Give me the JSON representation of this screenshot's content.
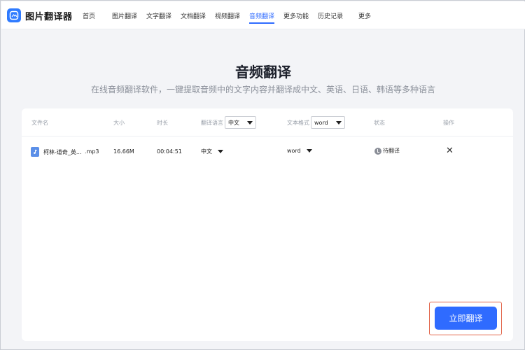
{
  "app": {
    "name": "图片翻译器",
    "accent_color": "#2f6bff"
  },
  "nav": {
    "items": [
      {
        "label": "首页"
      },
      {
        "label": "图片翻译"
      },
      {
        "label": "文字翻译"
      },
      {
        "label": "文档翻译"
      },
      {
        "label": "视频翻译"
      },
      {
        "label": "音频翻译",
        "active": true
      },
      {
        "label": "更多功能"
      },
      {
        "label": "历史记录"
      },
      {
        "label": "更多"
      }
    ]
  },
  "page": {
    "title": "音频翻译",
    "subtitle": "在线音频翻译软件，一键提取音频中的文字内容并翻译成中文、英语、日语、韩语等多种语言"
  },
  "table": {
    "headers": {
      "filename": "文件名",
      "size": "大小",
      "duration": "时长",
      "language": "翻译语言",
      "format": "文本格式",
      "status": "状态",
      "action": "操作"
    },
    "header_language_select": "中文",
    "header_format_select": "word",
    "rows": [
      {
        "file_icon": "audio-file-icon",
        "filename": "柯林-道奇_英...",
        "ext": ".mp3",
        "size": "16.66M",
        "duration": "00:04:51",
        "language": "中文",
        "format": "word",
        "status": "待翻译",
        "status_icon": "clock-icon",
        "action_icon": "close-icon"
      }
    ]
  },
  "actions": {
    "translate_button": "立即翻译"
  }
}
